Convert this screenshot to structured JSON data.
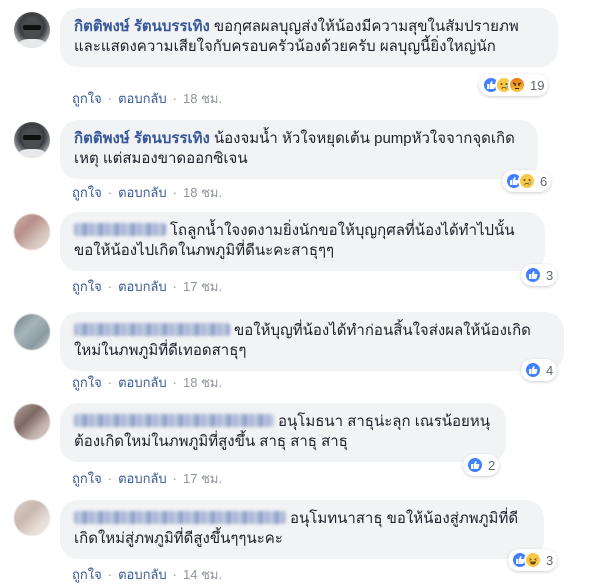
{
  "comments": [
    {
      "author": "กิตติพงษ์ รัตนบรรเทิง",
      "text": "ขอกุศลผลบุญส่งให้น้องมีความสุขในสัมปรายภพและแสดงความเสียใจกับครอบครัวน้องด้วยครับ ผลบุญนี้ยิ่งใหญ่นัก",
      "reaction_icons": [
        "like-icon",
        "sad-icon",
        "angry-icon"
      ],
      "reaction_count": "19",
      "like_label": "ถูกใจ",
      "reply_label": "ตอบกลับ",
      "time": "18 ชม."
    },
    {
      "author": "กิตติพงษ์ รัตนบรรเทิง",
      "text": "น้องจมน้ำ หัวใจหยุดเต้น pumpหัวใจจากจุดเกิดเหตุ แต่สมองขาดออกซิเจน",
      "reaction_icons": [
        "like-icon",
        "sad-icon"
      ],
      "reaction_count": "6",
      "like_label": "ถูกใจ",
      "reply_label": "ตอบกลับ",
      "time": "18 ชม."
    },
    {
      "author": "",
      "text": "โถลูกน้ำใจงดงามยิ่งนักขอให้บุญกุศลที่น้องได้ทำไปนั้นขอให้น้องไปเกิดในภพภูมิที่ดีนะคะสาธุๆๆ",
      "reaction_icons": [
        "like-icon"
      ],
      "reaction_count": "3",
      "like_label": "ถูกใจ",
      "reply_label": "ตอบกลับ",
      "time": "17 ชม."
    },
    {
      "author": "",
      "text": "ขอให้บุญที่น้องได้ทำก่อนสิ้นใจส่งผลให้น้องเกิดใหม่ในภพภูมิที่ดีเทอดสาธุๆ",
      "reaction_icons": [
        "like-icon"
      ],
      "reaction_count": "4",
      "like_label": "ถูกใจ",
      "reply_label": "ตอบกลับ",
      "time": "18 ชม."
    },
    {
      "author": "",
      "text": "อนุโมธนา สาธุน่ะลุก เณรน้อยหนุต้องเกิดใหม่ในภพภูมิที่สูงขึ้น สาธุ สาธุ สาธุ",
      "reaction_icons": [
        "like-icon"
      ],
      "reaction_count": "2",
      "like_label": "ถูกใจ",
      "reply_label": "ตอบกลับ",
      "time": "17 ชม."
    },
    {
      "author": "",
      "text": "อนุโมทนาสาธุ ขอให้น้องสู่ภพภูมิที่ดีเกิดใหม่สู่ภพภูมิที่ดีสูงขึ้นๆๆนะคะ",
      "reaction_icons": [
        "like-icon",
        "haha-icon"
      ],
      "reaction_count": "3",
      "like_label": "ถูกใจ",
      "reply_label": "ตอบกลับ",
      "time": "14 ชม."
    }
  ],
  "colors": {
    "author": "#385898",
    "bubble": "#f2f3f5",
    "like": "#4080ff",
    "meta": "#90949c"
  }
}
